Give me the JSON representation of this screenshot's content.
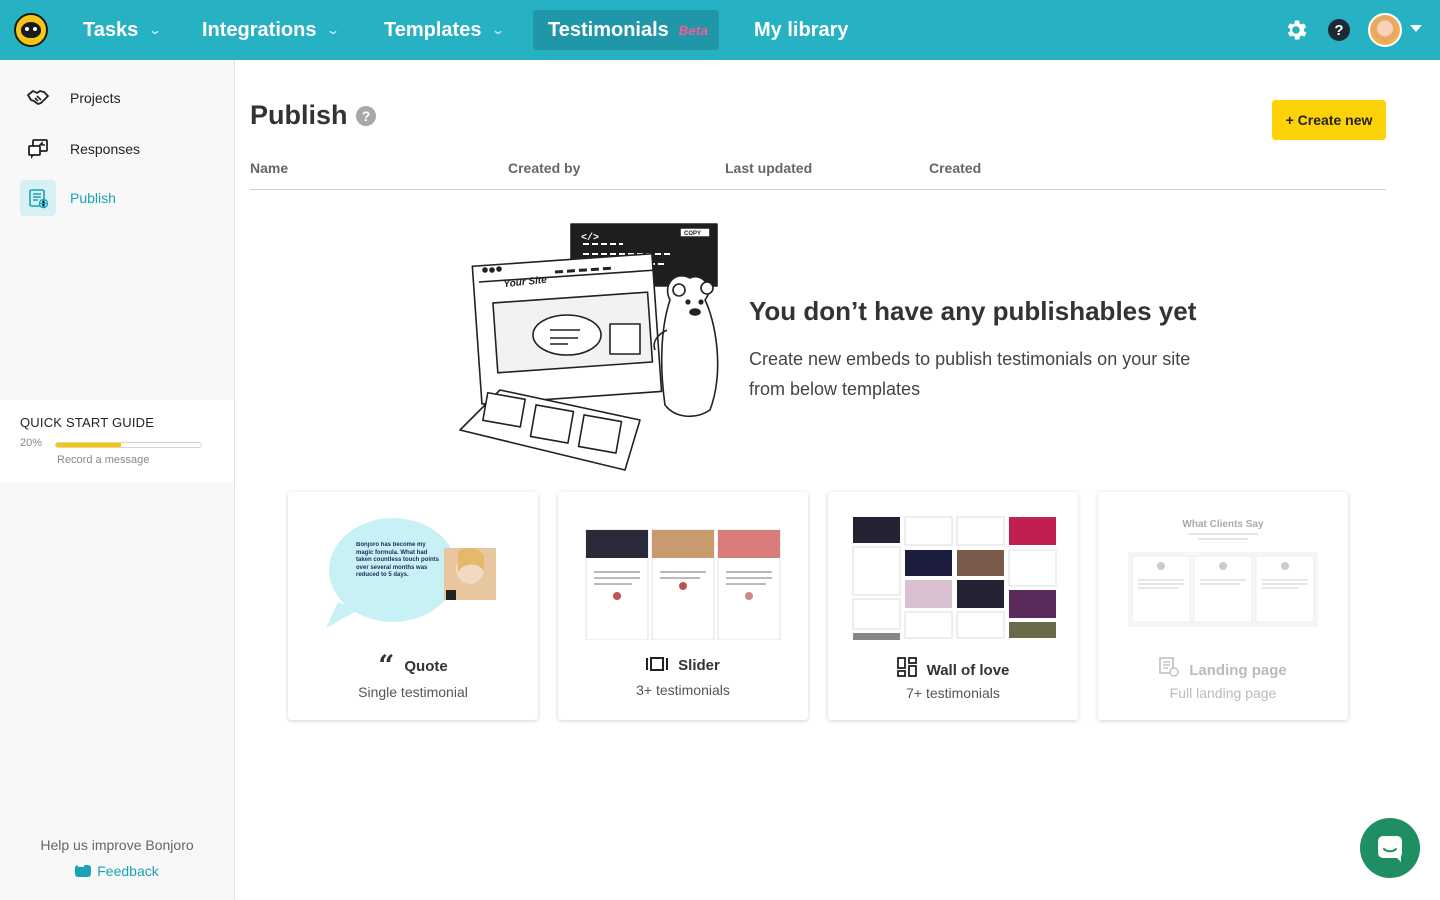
{
  "topbar": {
    "nav": [
      {
        "label": "Tasks",
        "has_caret": true
      },
      {
        "label": "Integrations",
        "has_caret": true
      },
      {
        "label": "Templates",
        "has_caret": true
      },
      {
        "label": "Testimonials",
        "badge": "Beta",
        "active": true
      },
      {
        "label": "My library"
      }
    ],
    "icons": [
      "settings-icon",
      "help-icon"
    ],
    "accent": "#27b2c4"
  },
  "sidebar": {
    "items": [
      {
        "label": "Projects",
        "icon": "handshake-icon"
      },
      {
        "label": "Responses",
        "icon": "responses-icon"
      },
      {
        "label": "Publish",
        "icon": "publish-icon",
        "active": true
      }
    ],
    "quick_start": {
      "title": "QUICK START GUIDE",
      "percent_label": "20%",
      "progress": 0.45,
      "next_step": "Record a message"
    },
    "help_text": "Help us improve Bonjoro",
    "feedback_label": "Feedback"
  },
  "main": {
    "title": "Publish",
    "create_button": "+ Create new",
    "columns": [
      "Name",
      "Created by",
      "Last updated",
      "Created"
    ],
    "empty": {
      "title": "You don’t have any publishables yet",
      "subtitle": "Create new embeds to publish testimonials on your site from below templates",
      "illustration_text": {
        "site": "Your Site",
        "copy": "COPY",
        "code": "</>"
      }
    },
    "templates": [
      {
        "label": "Quote",
        "desc": "Single testimonial",
        "icon": "quote-icon",
        "preview_text": "Bonjoro has become my magic formula. What had taken countless touch points over several months was reduced to 5 days."
      },
      {
        "label": "Slider",
        "desc": "3+ testimonials",
        "icon": "slider-icon"
      },
      {
        "label": "Wall of love",
        "desc": "7+ testimonials",
        "icon": "wall-icon"
      },
      {
        "label": "Landing page",
        "desc": "Full landing page",
        "icon": "landing-page-icon",
        "disabled": true,
        "preview_text": "What Clients Say"
      }
    ]
  }
}
